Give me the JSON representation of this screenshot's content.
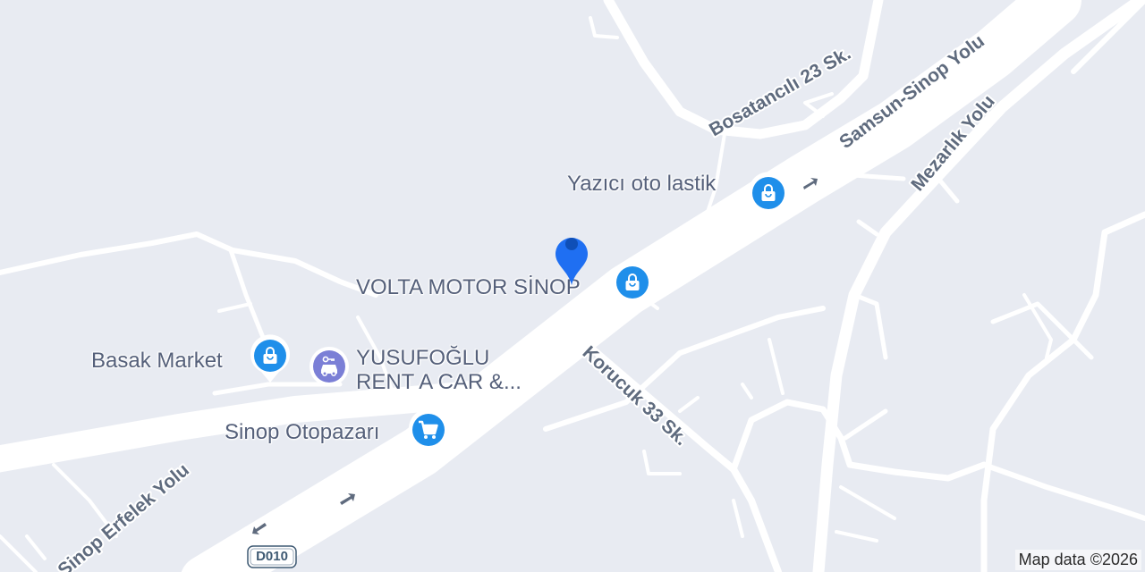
{
  "map": {
    "colors": {
      "background": "#e8ebf2",
      "road": "#ffffff",
      "pin_blue": "#1f8fea",
      "pin_purple": "#7b7fd6",
      "location_pin": "#1f6ff2"
    },
    "road_labels": {
      "bosatancili": "Bosatancılı 23 Sk.",
      "samsun_sinop": "Samsun-Sinop Yolu",
      "mezarlik": "Mezarlık Yolu",
      "korucuk": "Korucuk 33 Sk.",
      "sinop_erfelek": "Sinop Erfelek Yolu"
    },
    "pois": {
      "yazici": {
        "label": "Yazıcı oto lastik",
        "icon": "shopping-bag-icon"
      },
      "volta": {
        "label": "VOLTA MOTOR SİNOP",
        "icon": "shopping-bag-icon"
      },
      "basak": {
        "label": "Basak Market",
        "icon": "shopping-bag-icon"
      },
      "yusufoglu": {
        "label": "YUSUFOĞLU RENT A CAR &...",
        "icon": "car-rental-icon"
      },
      "otopazari": {
        "label": "Sinop Otopazarı",
        "icon": "shopping-cart-icon"
      }
    },
    "route_shield": "D010",
    "attribution": "Map data ©2026"
  }
}
